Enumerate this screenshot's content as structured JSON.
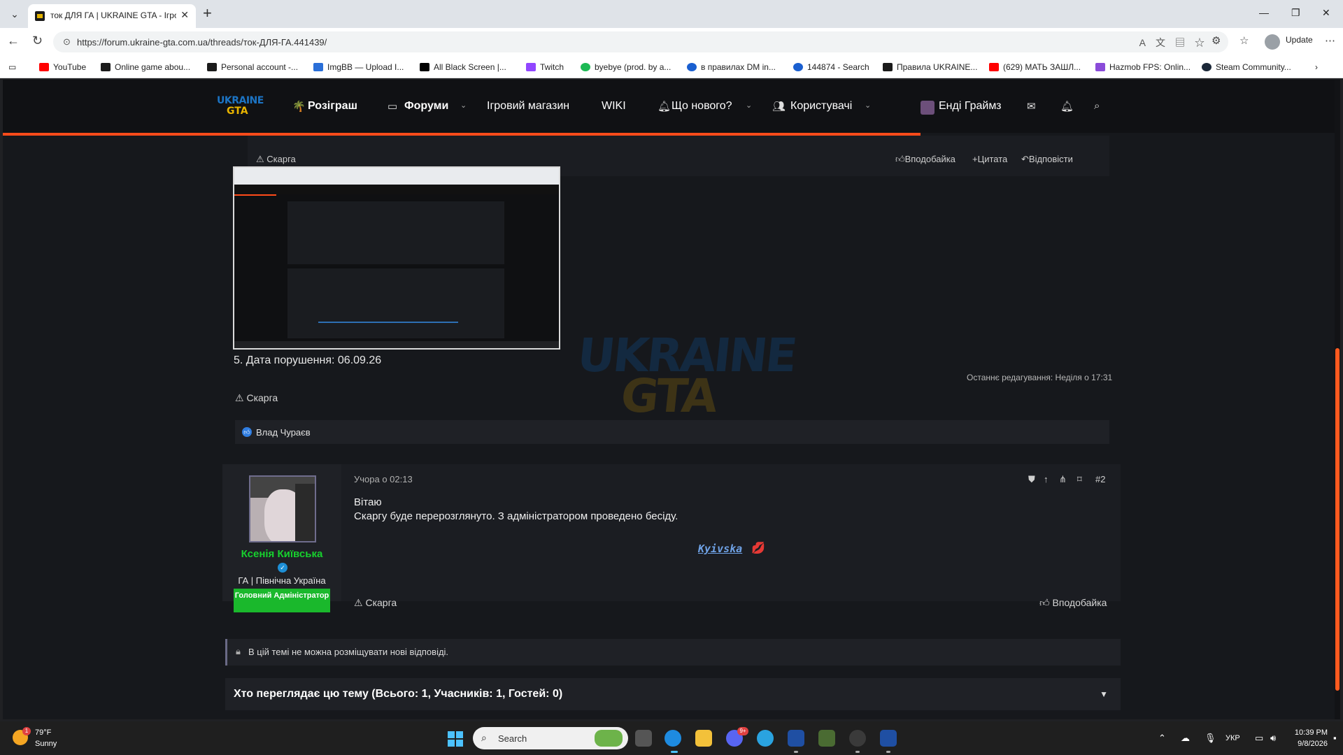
{
  "browser": {
    "tab_title": "ток ДЛЯ ГА | UKRAINE GTA - Ігро",
    "url": "https://forum.ukraine-gta.com.ua/threads/ток-ДЛЯ-ГА.441439/",
    "update_label": "Update"
  },
  "bookmarks": [
    {
      "label": "YouTube",
      "color": "#ff0000"
    },
    {
      "label": "Online game abou...",
      "color": "#1b1b1b"
    },
    {
      "label": "Personal account -...",
      "color": "#1b1b1b"
    },
    {
      "label": "ImgBB — Upload I...",
      "color": "#2a6fd8"
    },
    {
      "label": "All Black Screen |...",
      "color": "#000000"
    },
    {
      "label": "Twitch",
      "color": "#9146ff"
    },
    {
      "label": "byebye (prod. by a...",
      "color": "#1db954"
    },
    {
      "label": "в правилах DM in...",
      "color": "#1a5fd0"
    },
    {
      "label": "144874 - Search",
      "color": "#1a5fd0"
    },
    {
      "label": "Правила UKRAINE...",
      "color": "#1b1b1b"
    },
    {
      "label": "(629) МАТЬ ЗАШЛ...",
      "color": "#ff0000"
    },
    {
      "label": "Hazmob FPS: Onlin...",
      "color": "#8a4bd9"
    },
    {
      "label": "Steam Community...",
      "color": "#1b2838"
    }
  ],
  "site_nav": {
    "logo_top": "UKRAINE",
    "logo_bottom": "GTA",
    "giveaway": "Розіграш",
    "forums": "Форуми",
    "shop": "Ігровий магазин",
    "wiki": "WIKI",
    "whats_new": "Що нового?",
    "users": "Користувачі",
    "account": "Енді Граймз"
  },
  "post1": {
    "quote_report": "Скарга",
    "quote_like": "Вподобайка",
    "quote_quote": "Цитата",
    "quote_reply": "Відповісти",
    "violation_date": "5. Дата порушення: 06.09.26",
    "last_edited": "Останнє редагування: Неділя о 17:31",
    "report": "Скарга",
    "liked_by": "Влад Чураєв"
  },
  "watermark": {
    "line1": "UKRAINE",
    "line2": "GTA"
  },
  "post2": {
    "date": "Учора о 02:13",
    "number": "#2",
    "author": "Ксенія Київська",
    "user_title": "ГА | Північна Україна",
    "banner": "Головний Адміністратор",
    "greeting": "Вітаю",
    "message": "Скаргу буде перерозглянуто. З адміністратором проведено бесіду.",
    "signature": "Kyivska",
    "report": "Скарга",
    "like": "Вподобайка"
  },
  "thread": {
    "locked_notice": "В цій темі не можна розміщувати нові відповіді.",
    "viewers": "Хто переглядає цю тему (Всього: 1, Учасників: 1, Гостей: 0)"
  },
  "taskbar": {
    "temp": "79°F",
    "condition": "Sunny",
    "weather_badge": "1",
    "search_placeholder": "Search",
    "language": "УКР",
    "time": "10:39 PM",
    "date": "9/8/2026",
    "discord_badge": "9+"
  }
}
